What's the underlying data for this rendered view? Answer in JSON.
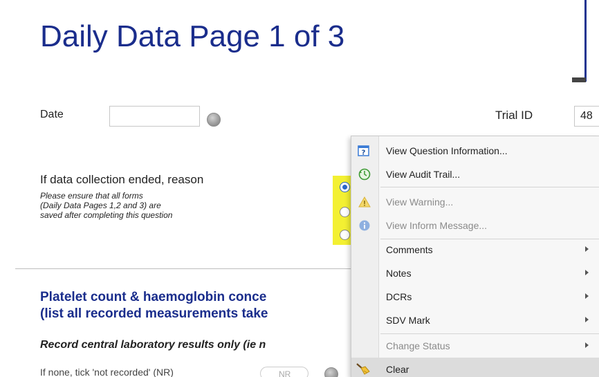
{
  "page": {
    "title": "Daily Data Page 1 of 3"
  },
  "form": {
    "date_label": "Date",
    "date_value": "",
    "trial_id_label": "Trial ID",
    "trial_id_value": "48",
    "reason_label": "If data collection ended, reason",
    "reason_hint": "Please ensure that all forms\n(Daily Data Pages 1,2 and 3) are\nsaved after completing this question",
    "section_title": "Platelet count & haemoglobin conce\n(list all recorded measurements take",
    "section_subtitle": "Record central laboratory results only (ie n",
    "not_recorded_text": "If none, tick 'not recorded' (NR)",
    "not_recorded_option": "NR"
  },
  "context_menu": {
    "items": [
      {
        "label": "View Question Information...",
        "icon": "question-info-icon",
        "enabled": true,
        "submenu": false
      },
      {
        "label": "View Audit Trail...",
        "icon": "audit-trail-icon",
        "enabled": true,
        "submenu": false
      },
      {
        "label": "View Warning...",
        "icon": "warning-icon",
        "enabled": false,
        "submenu": false
      },
      {
        "label": "View Inform Message...",
        "icon": "info-icon",
        "enabled": false,
        "submenu": false
      },
      {
        "label": "Comments",
        "icon": "",
        "enabled": true,
        "submenu": true
      },
      {
        "label": "Notes",
        "icon": "",
        "enabled": true,
        "submenu": true
      },
      {
        "label": "DCRs",
        "icon": "",
        "enabled": true,
        "submenu": true
      },
      {
        "label": "SDV Mark",
        "icon": "",
        "enabled": true,
        "submenu": true
      },
      {
        "label": "Change Status",
        "icon": "",
        "enabled": false,
        "submenu": true
      },
      {
        "label": "Clear",
        "icon": "broom-icon",
        "enabled": true,
        "submenu": false
      }
    ]
  },
  "colors": {
    "title": "#1a2d8c",
    "highlight": "#f3f032",
    "menu_background": "#f7f7f7"
  }
}
